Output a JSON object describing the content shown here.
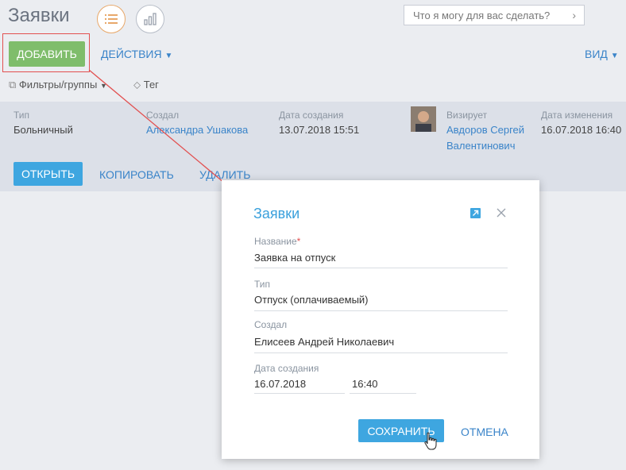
{
  "header": {
    "title": "Заявки",
    "search_placeholder": "Что я могу для вас сделать?",
    "search_icon": "chevron-right-icon"
  },
  "toolbar": {
    "add_label": "ДОБАВИТЬ",
    "actions_label": "ДЕЙСТВИЯ",
    "view_label": "ВИД",
    "filters_label": "Фильтры/группы",
    "tag_label": "Тег"
  },
  "record": {
    "type_label": "Тип",
    "type_value": "Больничный",
    "created_by_label": "Создал",
    "created_by_value": "Александра Ушакова",
    "created_date_label": "Дата создания",
    "created_date_value": "13.07.2018 15:51",
    "approver_label": "Визирует",
    "approver_line1": "Авдоров Сергей",
    "approver_line2": "Валентинович",
    "modified_label": "Дата изменения",
    "modified_value": "16.07.2018 16:40",
    "open_label": "ОТКРЫТЬ",
    "copy_label": "КОПИРОВАТЬ",
    "delete_label": "УДАЛИТЬ"
  },
  "dialog": {
    "title": "Заявки",
    "name_label": "Название",
    "required_mark": "*",
    "name_value": "Заявка на отпуск",
    "type_label": "Тип",
    "type_value": "Отпуск (оплачиваемый)",
    "created_by_label": "Создал",
    "created_by_value": "Елисеев Андрей Николаевич",
    "created_date_label": "Дата создания",
    "created_date_value": "16.07.2018",
    "created_time_value": "16:40",
    "save_label": "СОХРАНИТЬ",
    "cancel_label": "ОТМЕНА"
  },
  "colors": {
    "accent_blue": "#3ea6e0",
    "add_green": "#7fbd6b",
    "highlight_red": "#e25050",
    "overlay": "#d9dde6"
  }
}
